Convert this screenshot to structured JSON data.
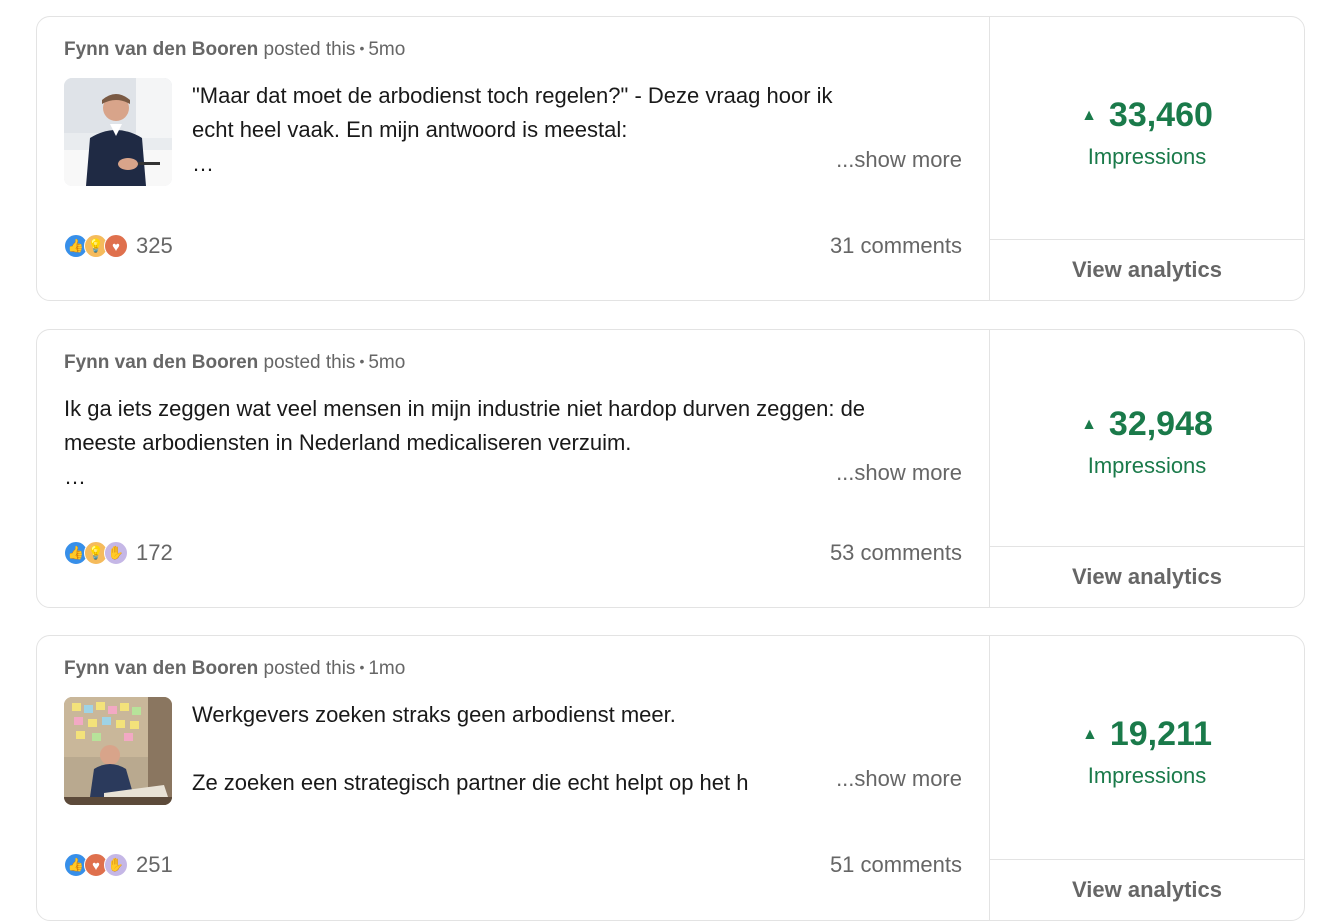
{
  "posts": [
    {
      "author": "Fynn van den Booren",
      "action": "posted this",
      "time": "5mo",
      "text": "\"Maar dat moet de arbodienst toch regelen?\" - Deze vraag hoor ik\necht heel vaak. En mijn antwoord is meestal:\n…",
      "show_more": "...show more",
      "reaction_icons": [
        "like-icon",
        "insightful-icon",
        "love-icon"
      ],
      "reactions": "325",
      "comments": "31 comments",
      "impressions": "33,460",
      "impressions_label": "Impressions",
      "view_analytics": "View analytics"
    },
    {
      "author": "Fynn van den Booren",
      "action": "posted this",
      "time": "5mo",
      "text": "Ik ga iets zeggen wat veel mensen in mijn industrie niet hardop durven zeggen: de\nmeeste arbodiensten in Nederland medicaliseren verzuim.\n…",
      "show_more": "...show more",
      "reaction_icons": [
        "like-icon",
        "insightful-icon",
        "support-icon"
      ],
      "reactions": "172",
      "comments": "53 comments",
      "impressions": "32,948",
      "impressions_label": "Impressions",
      "view_analytics": "View analytics"
    },
    {
      "author": "Fynn van den Booren",
      "action": "posted this",
      "time": "1mo",
      "text_line1": "Werkgevers zoeken straks geen arbodienst meer.",
      "text_line2": "Ze zoeken een strategisch partner die echt helpt op het h",
      "show_more": "...show more",
      "reaction_icons": [
        "like-icon",
        "love-icon",
        "support-icon"
      ],
      "reactions": "251",
      "comments": "51 comments",
      "impressions": "19,211",
      "impressions_label": "Impressions",
      "view_analytics": "View analytics"
    }
  ],
  "colors": {
    "impressions_green": "#1a7a4a",
    "muted_text": "#666666",
    "border": "#e3e3e3"
  }
}
